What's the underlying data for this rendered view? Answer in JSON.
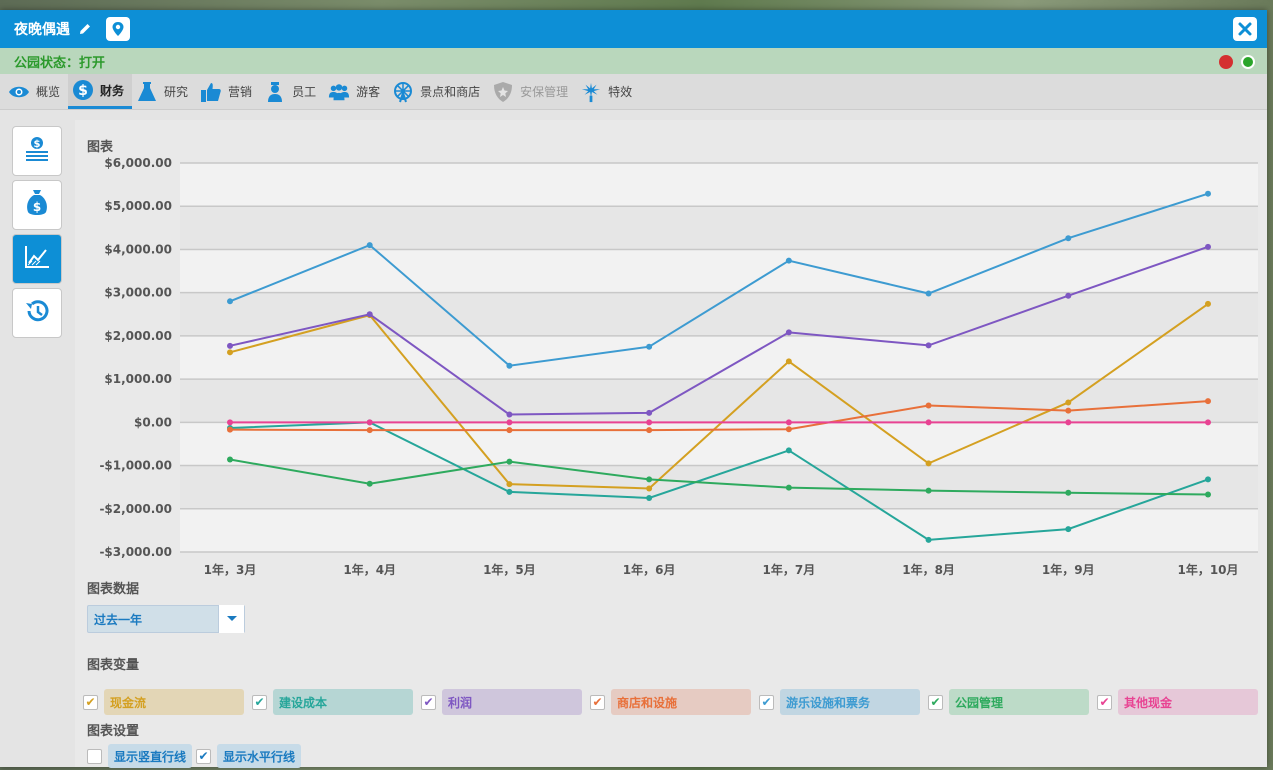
{
  "window": {
    "title": "夜晚偶遇",
    "status": "公园状态：打开"
  },
  "tabs": [
    {
      "label": "概览",
      "icon": "eye-icon"
    },
    {
      "label": "财务",
      "icon": "dollar-icon"
    },
    {
      "label": "研究",
      "icon": "flask-icon"
    },
    {
      "label": "营销",
      "icon": "thumbs-up-icon"
    },
    {
      "label": "员工",
      "icon": "staff-icon"
    },
    {
      "label": "游客",
      "icon": "guests-icon"
    },
    {
      "label": "景点和商店",
      "icon": "ferris-wheel-icon"
    },
    {
      "label": "安保管理",
      "icon": "shield-icon"
    },
    {
      "label": "特效",
      "icon": "fireworks-icon"
    }
  ],
  "active_tab": "财务",
  "sidebar": [
    {
      "name": "finance-summary-icon"
    },
    {
      "name": "money-bag-icon"
    },
    {
      "name": "chart-icon",
      "active": true
    },
    {
      "name": "history-icon"
    }
  ],
  "labels": {
    "chart": "图表",
    "chart_data_label": "图表数据",
    "chart_vars": "图表变量",
    "chart_settings": "图表设置"
  },
  "dropdown": {
    "value": "过去一年"
  },
  "variables": [
    {
      "label": "现金流",
      "color": "#d4a021",
      "bg": "#e3d6b6",
      "checked": true
    },
    {
      "label": "建设成本",
      "color": "#26a69a",
      "bg": "#b6d6d4",
      "checked": true
    },
    {
      "label": "利润",
      "color": "#7e57c2",
      "bg": "#cfc6dc",
      "checked": true
    },
    {
      "label": "商店和设施",
      "color": "#e8703a",
      "bg": "#e6cbc2",
      "checked": true
    },
    {
      "label": "游乐设施和票务",
      "color": "#3d9bd1",
      "bg": "#c1d6e2",
      "checked": true
    },
    {
      "label": "公园管理",
      "color": "#2eaa5e",
      "bg": "#bddbc8",
      "checked": true
    },
    {
      "label": "其他现金",
      "color": "#e84393",
      "bg": "#e6c8d8",
      "checked": true
    }
  ],
  "settings": [
    {
      "label": "显示竖直行线",
      "checked": false
    },
    {
      "label": "显示水平行线",
      "checked": true
    }
  ],
  "chart_data": {
    "type": "line",
    "categories": [
      "1年，3月",
      "1年，4月",
      "1年，5月",
      "1年，6月",
      "1年，7月",
      "1年，8月",
      "1年，9月",
      "1年，10月"
    ],
    "y_ticks": [
      "$6,000.00",
      "$5,000.00",
      "$4,000.00",
      "$3,000.00",
      "$2,000.00",
      "$1,000.00",
      "$0.00",
      "-$1,000.00",
      "-$2,000.00",
      "-$3,000.00"
    ],
    "ylim": [
      -3000,
      6000
    ],
    "grid": "horizontal",
    "series": [
      {
        "name": "现金流",
        "color": "#d4a021",
        "values": [
          1620,
          2480,
          -1430,
          -1530,
          1410,
          -950,
          460,
          2740
        ]
      },
      {
        "name": "建设成本",
        "color": "#26a69a",
        "values": [
          -130,
          0,
          -1610,
          -1750,
          -650,
          -2720,
          -2470,
          -1320
        ]
      },
      {
        "name": "利润",
        "color": "#7e57c2",
        "values": [
          1770,
          2500,
          180,
          220,
          2080,
          1780,
          2930,
          4060
        ]
      },
      {
        "name": "商店和设施",
        "color": "#e8703a",
        "values": [
          -170,
          -180,
          -180,
          -180,
          -160,
          390,
          270,
          490
        ]
      },
      {
        "name": "游乐设施和票务",
        "color": "#3d9bd1",
        "values": [
          2800,
          4100,
          1310,
          1750,
          3740,
          2980,
          4260,
          5290
        ]
      },
      {
        "name": "公园管理",
        "color": "#2eaa5e",
        "values": [
          -860,
          -1420,
          -910,
          -1320,
          -1510,
          -1580,
          -1630,
          -1670
        ]
      },
      {
        "name": "其他现金",
        "color": "#e84393",
        "values": [
          0,
          0,
          0,
          0,
          0,
          0,
          0,
          0
        ]
      }
    ]
  }
}
